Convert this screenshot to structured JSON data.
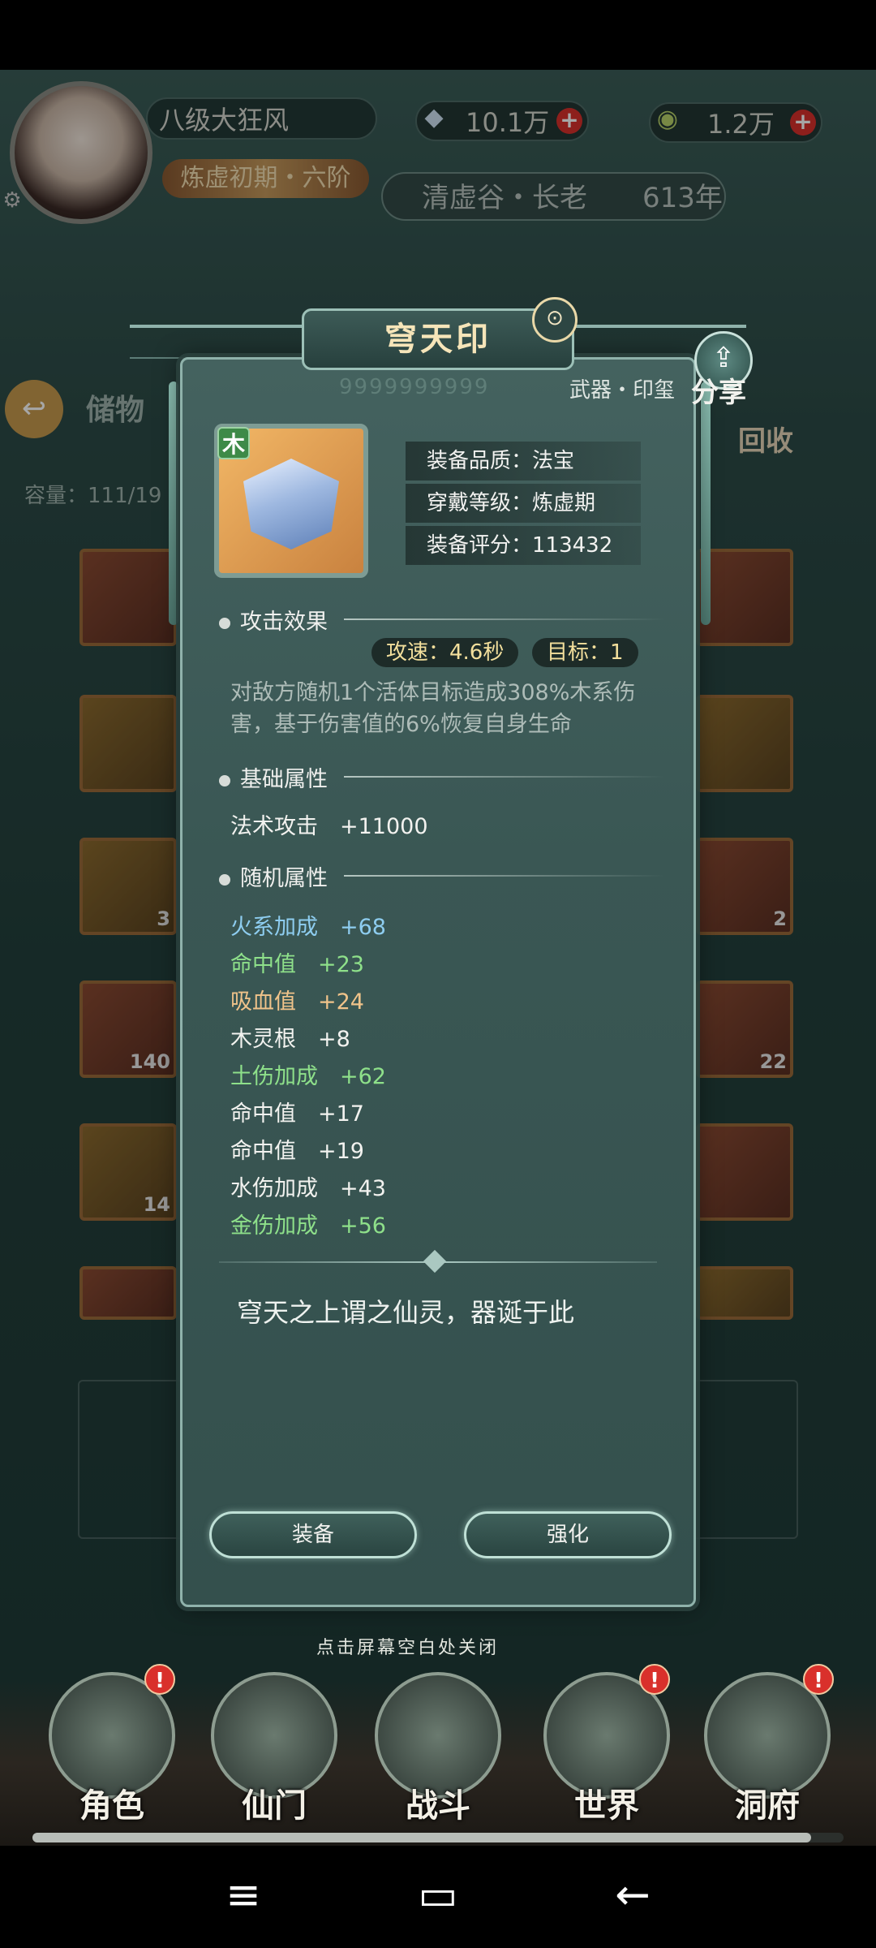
{
  "hud": {
    "player_name": "八级大狂风",
    "realm": "炼虚初期・六阶",
    "currency_1": {
      "value": "10.1万",
      "icon": "spirit-stone-icon"
    },
    "currency_2": {
      "value": "1.2万",
      "icon": "jade-token-icon"
    },
    "plus": "+",
    "sect": "清虚谷・长老",
    "age": "613年"
  },
  "storage": {
    "title": "储物",
    "capacity": "容量：111/19",
    "recycle": "回收",
    "slot_counts": [
      "3",
      "2",
      "140",
      "22",
      "14"
    ]
  },
  "item": {
    "name": "穹天印",
    "element": "木",
    "category": "武器・印玺",
    "share_label": "分享",
    "dots": "9999999999",
    "stats": [
      {
        "label": "装备品质：法宝"
      },
      {
        "label": "穿戴等级：炼虚期"
      },
      {
        "label": "装备评分：113432"
      }
    ],
    "attack_section": "攻击效果",
    "attack_speed": "攻速：4.6秒",
    "target": "目标：1",
    "description": "对敌方随机1个活体目标造成308%木系伤害，基于伤害值的6%恢复自身生命",
    "base_section": "基础属性",
    "base_attr": "法术攻击　+11000",
    "random_section": "随机属性",
    "random_attrs": [
      {
        "text": "火系加成　+68",
        "color": "#8ecdf0"
      },
      {
        "text": "命中值　+23",
        "color": "#8ee08a"
      },
      {
        "text": "吸血值　+24",
        "color": "#f0c38a"
      },
      {
        "text": "木灵根　+8",
        "color": "#f2f2ef"
      },
      {
        "text": "土伤加成　+62",
        "color": "#8ee08a"
      },
      {
        "text": "命中值　+17",
        "color": "#f2f2ef"
      },
      {
        "text": "命中值　+19",
        "color": "#f2f2ef"
      },
      {
        "text": "水伤加成　+43",
        "color": "#f2f2ef"
      },
      {
        "text": "金伤加成　+56",
        "color": "#8ee08a"
      }
    ],
    "flavor": "穹天之上谓之仙灵，器诞于此",
    "equip_button": "装备",
    "upgrade_button": "强化"
  },
  "close_hint": "点击屏幕空白处关闭",
  "nav": [
    {
      "label": "角色",
      "badge": "!"
    },
    {
      "label": "仙门",
      "badge": ""
    },
    {
      "label": "战斗",
      "badge": ""
    },
    {
      "label": "世界",
      "badge": "!"
    },
    {
      "label": "洞府",
      "badge": "!"
    }
  ],
  "progress_fraction": 0.96,
  "system_nav": {
    "menu": "≡",
    "home": "▭",
    "back": "←"
  }
}
